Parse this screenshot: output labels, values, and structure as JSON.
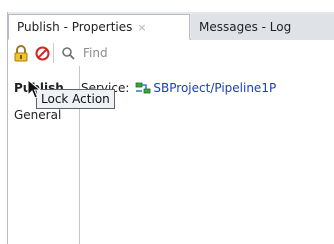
{
  "tabs": [
    {
      "label": "Publish - Properties",
      "close": "×",
      "active": true
    },
    {
      "label": "Messages - Log",
      "active": false
    }
  ],
  "toolbar": {
    "lock_icon": "lock-icon",
    "stop_icon": "no-entry-icon",
    "search_icon": "search-icon",
    "search_placeholder": "Find"
  },
  "left_pane": {
    "heading": "Publish",
    "items": [
      "General"
    ]
  },
  "main": {
    "service_label": "Service:",
    "service_icon": "pipeline-icon",
    "service_value": "SBProject/Pipeline1P"
  },
  "tooltip": {
    "text": "Lock Action"
  },
  "colors": {
    "link": "#1a3ec2",
    "stop": "#d9231f",
    "lock": "#e0a300",
    "tooltip_bg": "#eef2f7"
  }
}
